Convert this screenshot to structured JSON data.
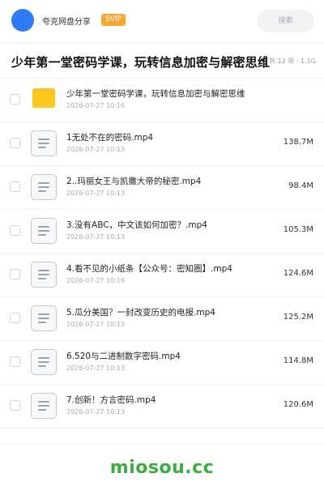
{
  "header": {
    "user_name": "夸克网盘分享",
    "badge": "SVIP",
    "search_placeholder": "搜索"
  },
  "folder_title": "少年第一堂密码学课，玩转信息加密与解密思维",
  "stats": "共 12 项 · 1.1G",
  "items": [
    {
      "type": "folder",
      "name": "少年第一堂密码学课，玩转信息加密与解密思维",
      "date": "2026-07-27 10:16",
      "size": ""
    },
    {
      "type": "file",
      "name": "1无处不在的密码.mp4",
      "date": "2026-07-27 10:13",
      "size": "138.7M"
    },
    {
      "type": "file",
      "name": "2..玛丽女王与凯撒大帝的秘密.mp4",
      "date": "2026-07-27 10:13",
      "size": "98.4M"
    },
    {
      "type": "file",
      "name": "3.没有ABC，中文该如何加密？.mp4",
      "date": "2026-07-27 10:13",
      "size": "105.3M"
    },
    {
      "type": "file",
      "name": "4.看不见的小纸条【公众号：密知圈】.mp4",
      "date": "2026-07-27 10:16",
      "size": "124.6M"
    },
    {
      "type": "file",
      "name": "5.瓜分美国？一封改变历史的电报.mp4",
      "date": "2026-07-27 10:13",
      "size": "125.2M"
    },
    {
      "type": "file",
      "name": "6.520与二进制数字密码.mp4",
      "date": "2026-07-27 10:13",
      "size": "114.8M"
    },
    {
      "type": "file",
      "name": "7.创新！方言密码.mp4",
      "date": "2026-07-27 10:13",
      "size": "120.6M"
    }
  ],
  "watermark": "miosou.cc",
  "colors": {
    "avatar": "#2f7bf6",
    "badge": "#f7a832",
    "folder": "#ffc81e",
    "watermark": "#3cae41"
  }
}
